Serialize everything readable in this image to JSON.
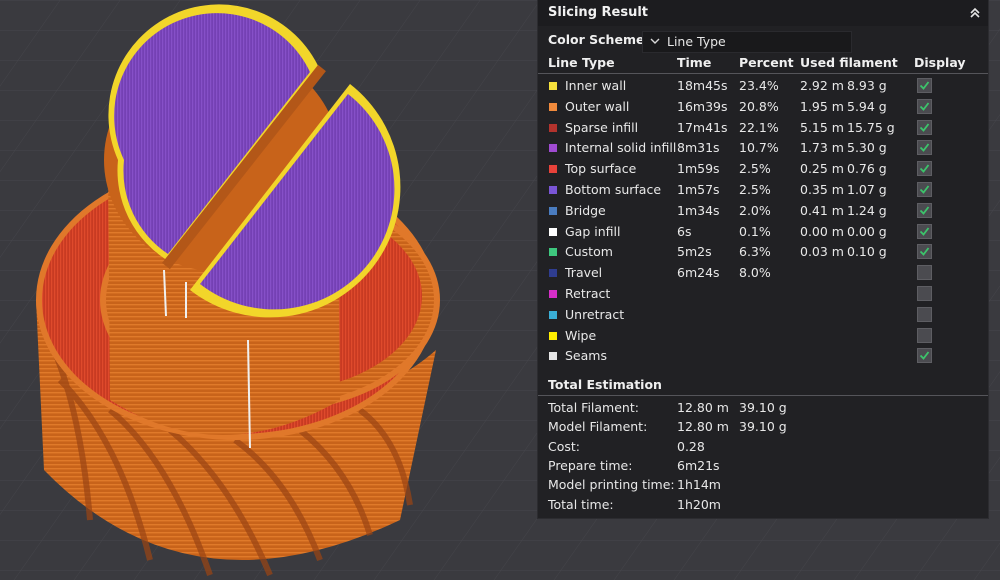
{
  "panel": {
    "title": "Slicing Result"
  },
  "color_scheme": {
    "label": "Color Scheme",
    "value": "Line Type"
  },
  "columns": {
    "line_type": "Line Type",
    "time": "Time",
    "percent": "Percent",
    "used_filament": "Used filament",
    "display": "Display"
  },
  "rows": [
    {
      "name": "Inner wall",
      "color": "#f6e13c",
      "time": "18m45s",
      "percent": "23.4%",
      "length": "2.92 m",
      "weight": "8.93 g",
      "display": true
    },
    {
      "name": "Outer wall",
      "color": "#f08a3c",
      "time": "16m39s",
      "percent": "20.8%",
      "length": "1.95 m",
      "weight": "5.94 g",
      "display": true
    },
    {
      "name": "Sparse infill",
      "color": "#b3332d",
      "time": "17m41s",
      "percent": "22.1%",
      "length": "5.15 m",
      "weight": "15.75 g",
      "display": true
    },
    {
      "name": "Internal solid infill",
      "color": "#a04bd2",
      "time": "8m31s",
      "percent": "10.7%",
      "length": "1.73 m",
      "weight": "5.30 g",
      "display": true
    },
    {
      "name": "Top surface",
      "color": "#e8423a",
      "time": "1m59s",
      "percent": "2.5%",
      "length": "0.25 m",
      "weight": "0.76 g",
      "display": true
    },
    {
      "name": "Bottom surface",
      "color": "#7a55d6",
      "time": "1m57s",
      "percent": "2.5%",
      "length": "0.35 m",
      "weight": "1.07 g",
      "display": true
    },
    {
      "name": "Bridge",
      "color": "#4a7cc0",
      "time": "1m34s",
      "percent": "2.0%",
      "length": "0.41 m",
      "weight": "1.24 g",
      "display": true
    },
    {
      "name": "Gap infill",
      "color": "#ffffff",
      "time": "6s",
      "percent": "0.1%",
      "length": "0.00 m",
      "weight": "0.00 g",
      "display": true
    },
    {
      "name": "Custom",
      "color": "#3ec77e",
      "time": "5m2s",
      "percent": "6.3%",
      "length": "0.03 m",
      "weight": "0.10 g",
      "display": true
    },
    {
      "name": "Travel",
      "color": "#2f3d90",
      "time": "6m24s",
      "percent": "8.0%",
      "length": "",
      "weight": "",
      "display": false
    },
    {
      "name": "Retract",
      "color": "#d62ec8",
      "time": "",
      "percent": "",
      "length": "",
      "weight": "",
      "display": false
    },
    {
      "name": "Unretract",
      "color": "#3aaed6",
      "time": "",
      "percent": "",
      "length": "",
      "weight": "",
      "display": false
    },
    {
      "name": "Wipe",
      "color": "#ffee00",
      "time": "",
      "percent": "",
      "length": "",
      "weight": "",
      "display": false
    },
    {
      "name": "Seams",
      "color": "#e6e6e6",
      "time": "",
      "percent": "",
      "length": "",
      "weight": "",
      "display": true
    }
  ],
  "total": {
    "title": "Total Estimation",
    "rows": [
      {
        "label": "Total Filament:",
        "v1": "12.80 m",
        "v2": "39.10 g"
      },
      {
        "label": "Model Filament:",
        "v1": "12.80 m",
        "v2": "39.10 g"
      },
      {
        "label": "Cost:",
        "v1": "0.28",
        "v2": ""
      },
      {
        "label": "Prepare time:",
        "v1": "6m21s",
        "v2": ""
      },
      {
        "label": "Model printing time:",
        "v1": "1h14m",
        "v2": ""
      },
      {
        "label": "Total time:",
        "v1": "1h20m",
        "v2": ""
      }
    ]
  },
  "icons": {
    "collapse": "double-chevron-up-icon",
    "dropdown": "chevron-down-icon",
    "check": "check-icon"
  },
  "model_colors": {
    "background": "#3a3a3f",
    "wall": "#c8631a",
    "infill": "#c83a22",
    "top": "#7a3fb8",
    "perimeter": "#f2d62a",
    "seam": "#f0f0f0"
  }
}
